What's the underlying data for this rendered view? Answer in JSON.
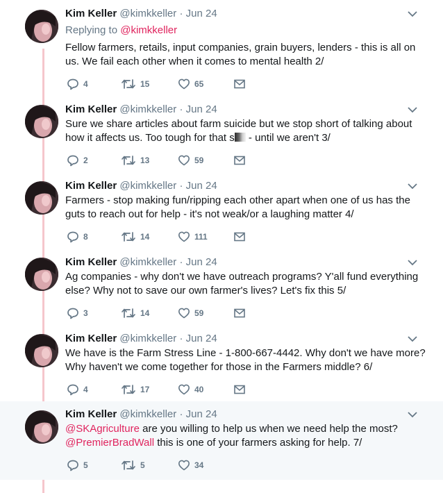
{
  "tweets": [
    {
      "name": "Kim Keller",
      "handle": "@kimkkeller",
      "sep": "·",
      "date": "Jun 24",
      "replying_label": "Replying to",
      "replying_handle": "@kimkkeller",
      "text": "Fellow farmers, retails, input companies, grain buyers, lenders - this is all on us. We fail each other when it comes to mental health 2/",
      "replies": "4",
      "retweets": "15",
      "likes": "65"
    },
    {
      "name": "Kim Keller",
      "handle": "@kimkkeller",
      "sep": "·",
      "date": "Jun 24",
      "text_before": "Sure we share articles about farm suicide but we stop short of talking about how it affects us. Too tough for that s",
      "text_after": " - until we aren't 3/",
      "replies": "2",
      "retweets": "13",
      "likes": "59"
    },
    {
      "name": "Kim Keller",
      "handle": "@kimkkeller",
      "sep": "·",
      "date": "Jun 24",
      "text": "Farmers - stop making fun/ripping each other apart when one of us has the guts to reach out for help - it's not weak/or a laughing matter 4/",
      "replies": "8",
      "retweets": "14",
      "likes": "111"
    },
    {
      "name": "Kim Keller",
      "handle": "@kimkkeller",
      "sep": "·",
      "date": "Jun 24",
      "text": "Ag companies - why don't we have outreach programs? Y'all fund everything else? Why not to save our own farmer's lives? Let's fix this 5/",
      "replies": "3",
      "retweets": "14",
      "likes": "59"
    },
    {
      "name": "Kim Keller",
      "handle": "@kimkkeller",
      "sep": "·",
      "date": "Jun 24",
      "text": "We have is the Farm Stress Line - 1-800-667-4442. Why don't we have more? Why haven't we come together for those in the Farmers middle? 6/",
      "replies": "4",
      "retweets": "17",
      "likes": "40"
    },
    {
      "name": "Kim Keller",
      "handle": "@kimkkeller",
      "sep": "·",
      "date": "Jun 24",
      "mention1": "@SKAgriculture",
      "text_mid": " are you willing to help us when we need help the most?",
      "mention2": "@PremierBradWall",
      "text_end": " this is one of your farmers asking for help. 7/",
      "replies": "5",
      "retweets": "5",
      "likes": "34"
    }
  ],
  "colors": {
    "accent": "#e0245e",
    "secondary_text": "#657786",
    "thread_line": "#f5c6cc",
    "highlight_bg": "#f5f8fa"
  },
  "icons": {
    "reply": "reply-icon",
    "retweet": "retweet-icon",
    "like": "heart-icon",
    "dm": "envelope-icon",
    "more": "chevron-down-icon"
  }
}
